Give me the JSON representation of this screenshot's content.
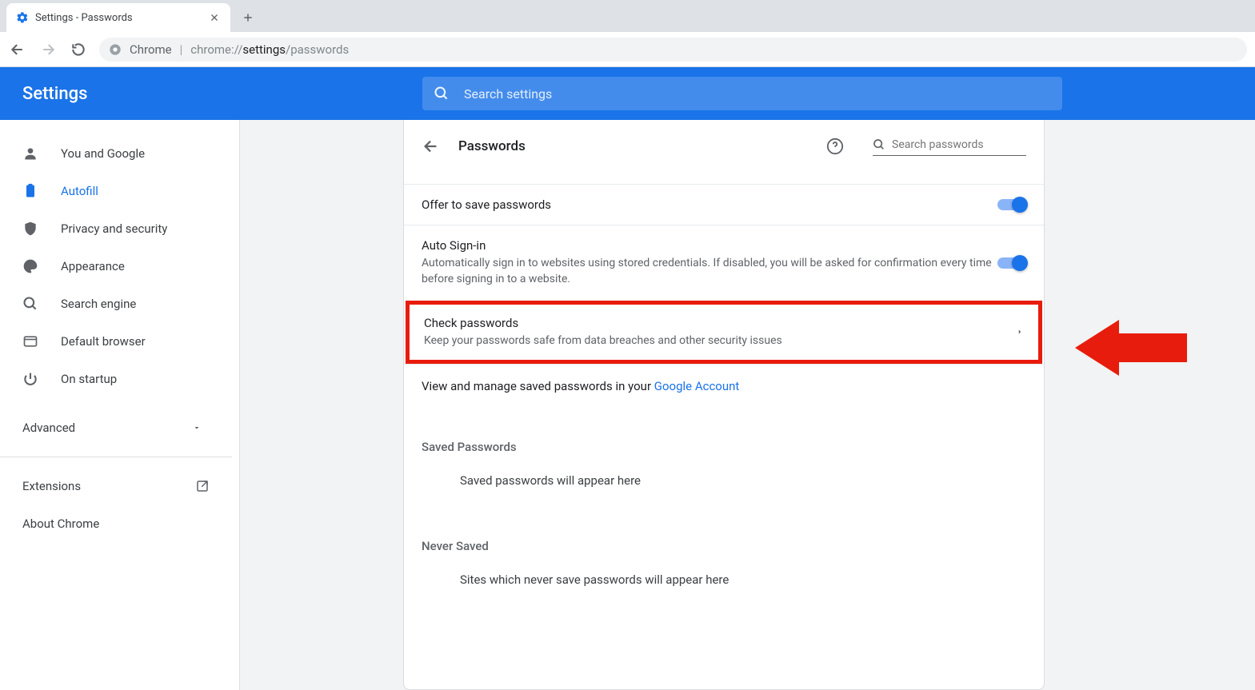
{
  "tab": {
    "title": "Settings - Passwords"
  },
  "omnibox": {
    "site_label": "Chrome",
    "url_prefix": "chrome://",
    "url_mid": "settings",
    "url_suffix": "/passwords"
  },
  "app": {
    "title": "Settings"
  },
  "search": {
    "placeholder": "Search settings"
  },
  "sidebar": {
    "items": [
      "You and Google",
      "Autofill",
      "Privacy and security",
      "Appearance",
      "Search engine",
      "Default browser",
      "On startup"
    ],
    "advanced": "Advanced",
    "extensions": "Extensions",
    "about": "About Chrome"
  },
  "main": {
    "title": "Passwords",
    "search_placeholder": "Search passwords",
    "offer_save": "Offer to save passwords",
    "auto_signin_title": "Auto Sign-in",
    "auto_signin_sub": "Automatically sign in to websites using stored credentials. If disabled, you will be asked for confirmation every time before signing in to a website.",
    "check_title": "Check passwords",
    "check_sub": "Keep your passwords safe from data breaches and other security issues",
    "view_manage_prefix": "View and manage saved passwords in your ",
    "view_manage_link": "Google Account",
    "saved_label": "Saved Passwords",
    "saved_empty": "Saved passwords will appear here",
    "never_label": "Never Saved",
    "never_empty": "Sites which never save passwords will appear here"
  }
}
